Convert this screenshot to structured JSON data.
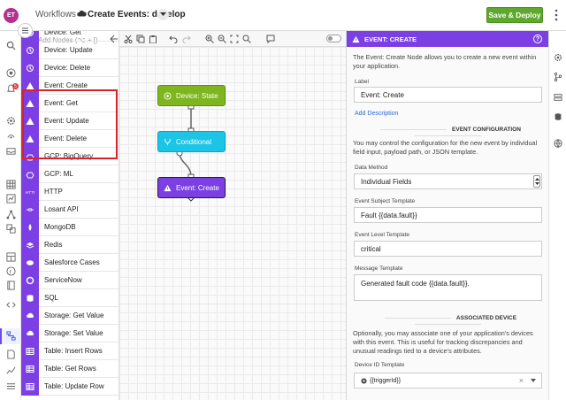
{
  "header": {
    "avatar_initials": "ET",
    "breadcrumb_root": "Workflows",
    "breadcrumb_separator": "›",
    "workflow_title": "Create Events: develop",
    "save_button": "Save & Deploy"
  },
  "palette": {
    "search_placeholder": "Add Nodes (⌥ + [)",
    "items": [
      {
        "label": "Device: Get",
        "icon": "device-icon",
        "color": "#7b3fe4"
      },
      {
        "label": "Device: Update",
        "icon": "device-icon",
        "color": "#7b3fe4"
      },
      {
        "label": "Device: Delete",
        "icon": "device-icon",
        "color": "#7b3fe4"
      },
      {
        "label": "Event: Create",
        "icon": "event-icon",
        "color": "#7b3fe4"
      },
      {
        "label": "Event: Get",
        "icon": "event-icon",
        "color": "#7b3fe4"
      },
      {
        "label": "Event: Update",
        "icon": "event-icon",
        "color": "#7b3fe4"
      },
      {
        "label": "Event: Delete",
        "icon": "event-icon",
        "color": "#7b3fe4"
      },
      {
        "label": "GCP: BigQuery",
        "icon": "gcp-icon",
        "color": "#7b3fe4"
      },
      {
        "label": "GCP: ML",
        "icon": "gcp-icon",
        "color": "#7b3fe4"
      },
      {
        "label": "HTTP",
        "icon": "http-icon",
        "color": "#7b3fe4"
      },
      {
        "label": "Losant API",
        "icon": "api-icon",
        "color": "#7b3fe4"
      },
      {
        "label": "MongoDB",
        "icon": "mongodb-icon",
        "color": "#7b3fe4"
      },
      {
        "label": "Redis",
        "icon": "redis-icon",
        "color": "#7b3fe4"
      },
      {
        "label": "Salesforce Cases",
        "icon": "salesforce-icon",
        "color": "#7b3fe4"
      },
      {
        "label": "ServiceNow",
        "icon": "servicenow-icon",
        "color": "#7b3fe4"
      },
      {
        "label": "SQL",
        "icon": "database-icon",
        "color": "#7b3fe4"
      },
      {
        "label": "Storage: Get Value",
        "icon": "storage-icon",
        "color": "#7b3fe4"
      },
      {
        "label": "Storage: Set Value",
        "icon": "storage-icon",
        "color": "#7b3fe4"
      },
      {
        "label": "Table: Insert Rows",
        "icon": "table-icon",
        "color": "#7b3fe4"
      },
      {
        "label": "Table: Get Rows",
        "icon": "table-icon",
        "color": "#7b3fe4"
      },
      {
        "label": "Table: Update Row",
        "icon": "table-icon",
        "color": "#7b3fe4"
      }
    ]
  },
  "canvas": {
    "nodes": [
      {
        "label": "Device: State",
        "color": "#7fb61f"
      },
      {
        "label": "Conditional",
        "color": "#1cc4e6"
      },
      {
        "label": "Event: Create",
        "color": "#7b3fe4"
      }
    ]
  },
  "panel": {
    "header_title": "EVENT: CREATE",
    "help_label": "?",
    "description": "The Event: Create Node allows you to create a new event within your application.",
    "label_field_label": "Label",
    "label_field_value": "Event: Create",
    "add_description_link": "Add Description",
    "config_section_title": "EVENT CONFIGURATION",
    "config_description": "You may control the configuration for the new event by individual field input, payload path, or JSON template.",
    "data_method_label": "Data Method",
    "data_method_value": "Individual Fields",
    "subject_label": "Event Subject Template",
    "subject_value": "Fault {{data.fault}}",
    "level_label": "Event Level Template",
    "level_value": "critical",
    "message_label": "Message Template",
    "message_value": "Generated fault code {{data.fault}}.",
    "device_section_title": "ASSOCIATED DEVICE",
    "device_description": "Optionally, you may associate one of your application's devices with this event. This is useful for tracking discrepancies and unusual readings tied to a device's attributes.",
    "device_id_label": "Device ID Template",
    "device_id_value": "{{triggerId}}",
    "device_id_clear": "×"
  },
  "colors": {
    "accent": "#7b3fe4",
    "save_green": "#5fa82e",
    "highlight_red": "#d8232a"
  }
}
